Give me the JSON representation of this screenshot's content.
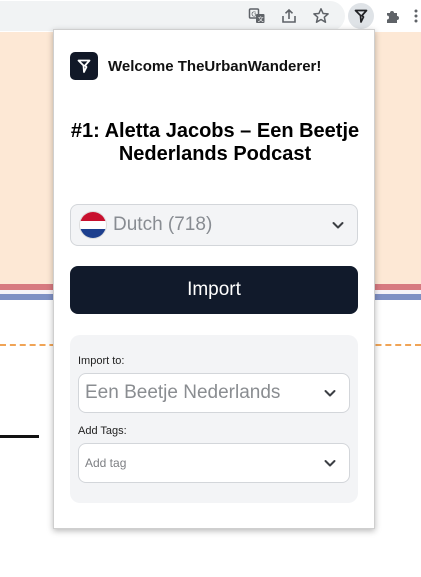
{
  "browser": {
    "icons": [
      "translate-icon",
      "share-icon",
      "star-icon",
      "extension-app-icon",
      "puzzle-icon"
    ]
  },
  "popup": {
    "welcome": "Welcome TheUrbanWanderer!",
    "title": "#1: Aletta Jacobs – Een Beetje Nederlands Podcast",
    "language": {
      "label": "Dutch (718)",
      "flag": "netherlands-flag"
    },
    "import_button": "Import",
    "import_to": {
      "label": "Import to:",
      "value": "Een Beetje Nederlands"
    },
    "tags": {
      "label": "Add Tags:",
      "placeholder": "Add tag"
    }
  },
  "colors": {
    "accent_dark": "#111a2b",
    "page_peach": "#fde8d5",
    "stripe_red": "#d77a80",
    "stripe_blue": "#7f90c4",
    "dashed_orange": "#f0a456"
  }
}
